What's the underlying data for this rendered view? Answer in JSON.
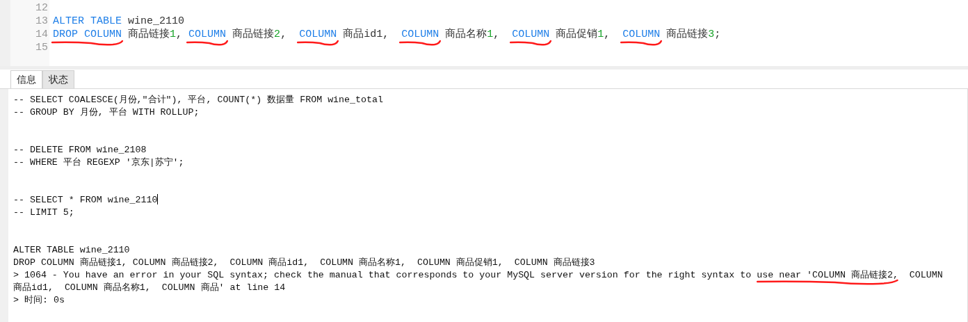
{
  "editor": {
    "lines": [
      {
        "number": "12"
      },
      {
        "number": "13",
        "tokens": [
          {
            "kind": "keyword",
            "text": "ALTER TABLE"
          },
          {
            "kind": "text",
            "text": " wine_2110"
          }
        ]
      },
      {
        "number": "14",
        "tokens": [
          {
            "kind": "keyword",
            "text": "DROP COLUMN",
            "underlined": true
          },
          {
            "kind": "text",
            "text": " 商品链接"
          },
          {
            "kind": "number",
            "text": "1"
          },
          {
            "kind": "text",
            "text": ", "
          },
          {
            "kind": "keyword",
            "text": "COLUMN",
            "underlined": true
          },
          {
            "kind": "text",
            "text": " 商品链接"
          },
          {
            "kind": "number",
            "text": "2"
          },
          {
            "kind": "text",
            "text": ",  "
          },
          {
            "kind": "keyword",
            "text": "COLUMN",
            "underlined": true
          },
          {
            "kind": "text",
            "text": " 商品id1,  "
          },
          {
            "kind": "keyword",
            "text": "COLUMN",
            "underlined": true
          },
          {
            "kind": "text",
            "text": " 商品名称"
          },
          {
            "kind": "number",
            "text": "1"
          },
          {
            "kind": "text",
            "text": ",  "
          },
          {
            "kind": "keyword",
            "text": "COLUMN",
            "underlined": true
          },
          {
            "kind": "text",
            "text": " 商品促销"
          },
          {
            "kind": "number",
            "text": "1"
          },
          {
            "kind": "text",
            "text": ",  "
          },
          {
            "kind": "keyword",
            "text": "COLUMN",
            "underlined": true
          },
          {
            "kind": "text",
            "text": " 商品链接"
          },
          {
            "kind": "number",
            "text": "3"
          },
          {
            "kind": "text",
            "text": ";"
          }
        ]
      },
      {
        "number": "15"
      }
    ]
  },
  "tabs": [
    {
      "label": "信息",
      "selected": true
    },
    {
      "label": "状态",
      "selected": false
    }
  ],
  "output": {
    "lines": [
      {
        "kind": "text",
        "text": "-- SELECT COALESCE(月份,\"合计\"), 平台, COUNT(*) 数据量 FROM wine_total"
      },
      {
        "kind": "text",
        "text": "-- GROUP BY 月份, 平台 WITH ROLLUP;"
      },
      {
        "kind": "blank"
      },
      {
        "kind": "blank"
      },
      {
        "kind": "text",
        "text": "-- DELETE FROM wine_2108"
      },
      {
        "kind": "text",
        "text": "-- WHERE 平台 REGEXP '京东|苏宁';"
      },
      {
        "kind": "blank"
      },
      {
        "kind": "blank"
      },
      {
        "kind": "text",
        "text": "-- SELECT * FROM wine_2110",
        "cursor": true
      },
      {
        "kind": "text",
        "text": "-- LIMIT 5;"
      },
      {
        "kind": "blank"
      },
      {
        "kind": "blank"
      },
      {
        "kind": "text",
        "text": "ALTER TABLE wine_2110"
      },
      {
        "kind": "text",
        "text": "DROP COLUMN 商品链接1, COLUMN 商品链接2,  COLUMN 商品id1,  COLUMN 商品名称1,  COLUMN 商品促销1,  COLUMN 商品链接3"
      },
      {
        "kind": "parts",
        "parts": [
          {
            "text": "> 1064 - You have an error in your SQL syntax; check the manual that corresponds to your MySQL server version for the right syntax to "
          },
          {
            "text": "use near 'COLUMN 商品链接2,",
            "underlined": true
          },
          {
            "text": "  COLUMN"
          }
        ]
      },
      {
        "kind": "text",
        "text": "商品id1,  COLUMN 商品名称1,  COLUMN 商品' at line 14"
      },
      {
        "kind": "text",
        "text": "> 时间: 0s"
      }
    ]
  }
}
